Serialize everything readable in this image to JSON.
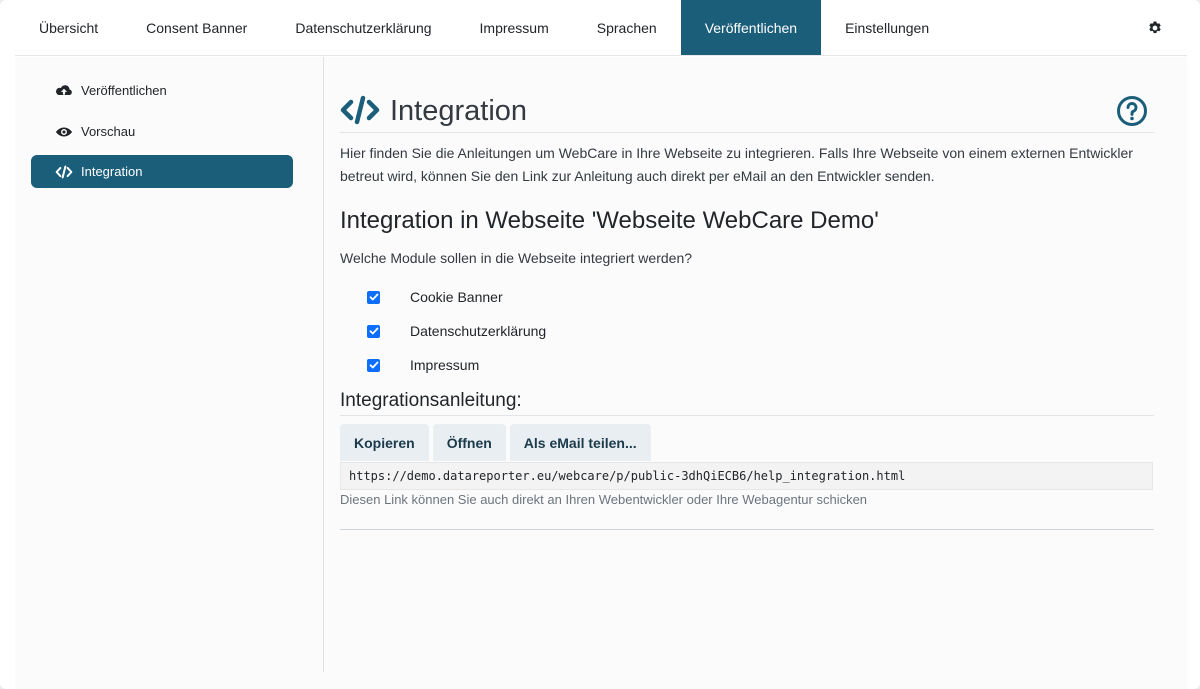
{
  "topnav": {
    "tabs": [
      {
        "label": "Übersicht"
      },
      {
        "label": "Consent Banner"
      },
      {
        "label": "Datenschutzerklärung"
      },
      {
        "label": "Impressum"
      },
      {
        "label": "Sprachen"
      },
      {
        "label": "Veröffentlichen",
        "active": true
      },
      {
        "label": "Einstellungen"
      }
    ],
    "settings_icon": "gear-icon"
  },
  "sidebar": {
    "items": [
      {
        "label": "Veröffentlichen",
        "icon": "cloud-upload-icon"
      },
      {
        "label": "Vorschau",
        "icon": "eye-icon"
      },
      {
        "label": "Integration",
        "icon": "code-icon",
        "active": true
      }
    ]
  },
  "main": {
    "title": "Integration",
    "help_icon": "question-circle-icon",
    "intro": "Hier finden Sie die Anleitungen um WebCare in Ihre Webseite zu integrieren. Falls Ihre Webseite von einem externen Entwickler betreut wird, können Sie den Link zur Anleitung auch direkt per eMail an den Entwickler senden.",
    "subtitle": "Integration in Webseite 'Webseite WebCare Demo'",
    "question": "Welche Module sollen in die Webseite integriert werden?",
    "modules": [
      {
        "label": "Cookie Banner",
        "checked": true
      },
      {
        "label": "Datenschutzerklärung",
        "checked": true
      },
      {
        "label": "Impressum",
        "checked": true
      }
    ],
    "guide_heading": "Integrationsanleitung:",
    "buttons": {
      "copy": "Kopieren",
      "open": "Öffnen",
      "email": "Als eMail teilen..."
    },
    "link": "https://demo.datareporter.eu/webcare/p/public-3dhQiECB6/help_integration.html",
    "hint": "Diesen Link können Sie auch direkt an Ihren Webentwickler oder Ihre Webagentur schicken"
  },
  "colors": {
    "accent": "#1b5e7a",
    "checkbox": "#0d6efd",
    "button_bg": "#e8eef2"
  }
}
